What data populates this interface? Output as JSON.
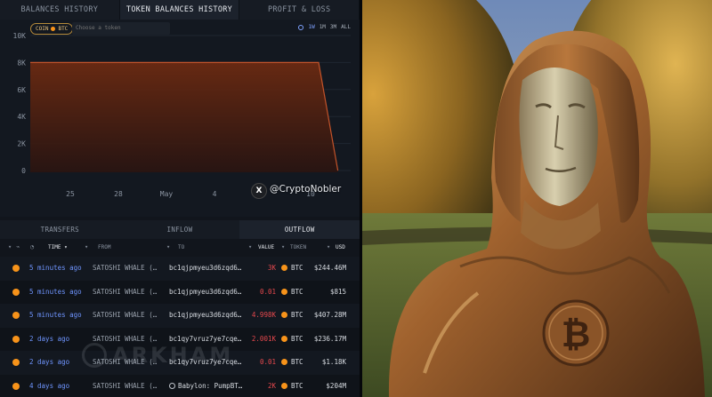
{
  "top_tabs": [
    "BALANCES HISTORY",
    "TOKEN BALANCES HISTORY",
    "PROFIT & LOSS"
  ],
  "chart_controls": {
    "coin_label": "COIN",
    "coin_value": "BTC",
    "token_placeholder": "Choose a token",
    "ranges": [
      "1W",
      "1M",
      "3M",
      "ALL"
    ],
    "active_range": "1W"
  },
  "chart_data": {
    "type": "area",
    "x": [
      "25",
      "28",
      "May",
      "4",
      "7",
      "10"
    ],
    "y_ticks": [
      "10K",
      "8K",
      "6K",
      "4K",
      "2K",
      "0"
    ],
    "ylim": [
      0,
      10000
    ],
    "series": [
      {
        "values": [
          {
            "t": 22.5,
            "v": 8000
          },
          {
            "t": 40.5,
            "v": 8000
          },
          {
            "t": 41.7,
            "v": 0
          }
        ]
      }
    ],
    "x_tick_positions": [
      25,
      28,
      31,
      34,
      37,
      40
    ],
    "color": "#8a3a1a"
  },
  "watermark": {
    "x_glyph": "X",
    "handle": "@CryptoNobler"
  },
  "sub_tabs": [
    "TRANSFERS",
    "INFLOW",
    "OUTFLOW"
  ],
  "active_sub_tab": "OUTFLOW",
  "columns": {
    "time": "TIME",
    "from": "FROM",
    "to": "TO",
    "value": "VALUE",
    "token": "TOKEN",
    "usd": "USD"
  },
  "rows": [
    {
      "time": "5 minutes ago",
      "from": "SATOSHI WHALE (…",
      "to": "bc1qjpmyeu3d6zqd6…",
      "value": "3K",
      "token": "BTC",
      "usd": "$244.46M",
      "to_icon": false
    },
    {
      "time": "5 minutes ago",
      "from": "SATOSHI WHALE (…",
      "to": "bc1qjpmyeu3d6zqd6…",
      "value": "0.01",
      "token": "BTC",
      "usd": "$815",
      "to_icon": false
    },
    {
      "time": "5 minutes ago",
      "from": "SATOSHI WHALE (…",
      "to": "bc1qjpmyeu3d6zqd6…",
      "value": "4.998K",
      "token": "BTC",
      "usd": "$407.28M",
      "to_icon": false
    },
    {
      "time": "2 days ago",
      "from": "SATOSHI WHALE (…",
      "to": "bc1qy7vruz7ye7cqe…",
      "value": "2.001K",
      "token": "BTC",
      "usd": "$236.17M",
      "to_icon": false
    },
    {
      "time": "2 days ago",
      "from": "SATOSHI WHALE (…",
      "to": "bc1qy7vruz7ye7cqe…",
      "value": "0.01",
      "token": "BTC",
      "usd": "$1.18K",
      "to_icon": false
    },
    {
      "time": "4 days ago",
      "from": "SATOSHI WHALE (…",
      "to": "Babylon: PumpBT…",
      "value": "2K",
      "token": "BTC",
      "usd": "$204M",
      "to_icon": true
    }
  ],
  "table_watermark": "ARKHAM",
  "photo": {
    "coin_symbol": "₿"
  },
  "colors": {
    "accent_blue": "#6f95ff",
    "negative_red": "#e5484d",
    "btc_orange": "#f7931a",
    "area_fill": "#6b2a12"
  }
}
